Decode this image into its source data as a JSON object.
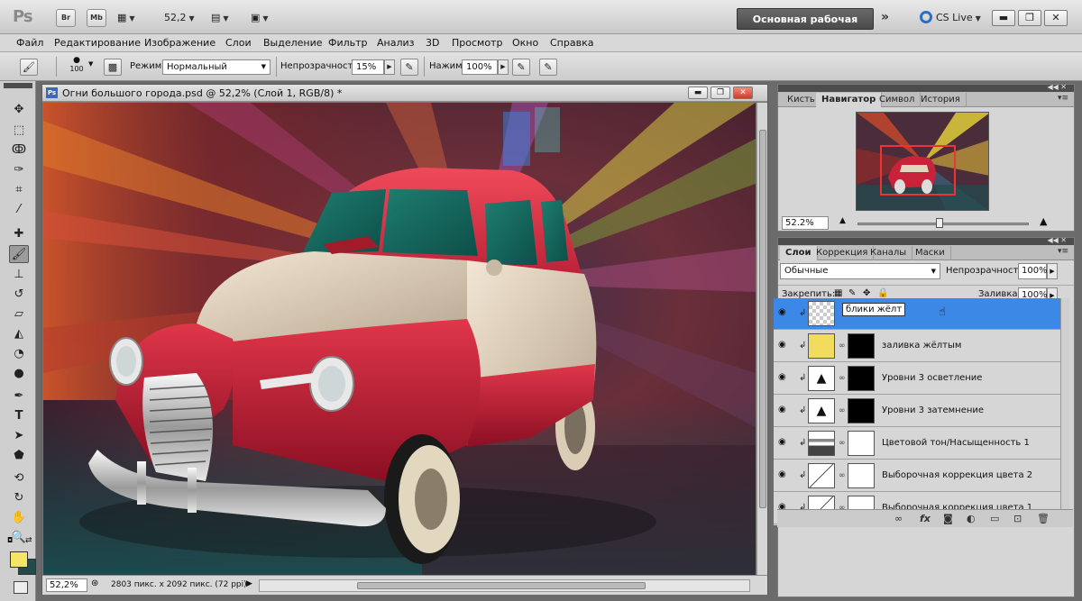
{
  "appbar": {
    "logo": "Ps",
    "br_label": "Br",
    "mb_label": "Mb",
    "zoom_value": "52,2",
    "workspace_label": "Основная рабочая среда",
    "more_label": "»",
    "cslive_label": "CS Live"
  },
  "menu": [
    "Файл",
    "Редактирование",
    "Изображение",
    "Слои",
    "Выделение",
    "Фильтр",
    "Анализ",
    "3D",
    "Просмотр",
    "Окно",
    "Справка"
  ],
  "options": {
    "brush_size": "100",
    "mode_label": "Режим:",
    "mode_value": "Нормальный",
    "opacity_label": "Непрозрачность:",
    "opacity_value": "15%",
    "flow_label": "Нажим:",
    "flow_value": "100%"
  },
  "document": {
    "title": "Огни большого города.psd @ 52,2% (Слой 1, RGB/8) *",
    "zoom": "52,2%",
    "info": "2803 пикс. x 2092 пикс. (72 ppi)"
  },
  "navigator_panel": {
    "tabs": [
      "Кисть",
      "Навигатор",
      "Символ",
      "История"
    ],
    "active_tab": 1,
    "zoom": "52.2%",
    "zoom_level": 0.48
  },
  "layers_panel": {
    "tabs": [
      "Слои",
      "Коррекция",
      "Каналы",
      "Маски"
    ],
    "active_tab": 0,
    "blend_mode": "Обычные",
    "opacity_label": "Непрозрачность:",
    "opacity_value": "100%",
    "lock_label": "Закрепить:",
    "fill_label": "Заливка:",
    "fill_value": "100%",
    "layers": [
      {
        "name": "блики жёлт",
        "editing": true,
        "selected": true,
        "thumb": "transparent"
      },
      {
        "name": "заливка жёлтым",
        "selected": false,
        "thumb": "yellow"
      },
      {
        "name": "Уровни 3 осветление",
        "selected": false,
        "thumb": "levels"
      },
      {
        "name": "Уровни 3 затемнение",
        "selected": false,
        "thumb": "levels"
      },
      {
        "name": "Цветовой тон/Насыщенность 1",
        "selected": false,
        "thumb": "hue"
      },
      {
        "name": "Выборочная коррекция цвета 2",
        "selected": false,
        "thumb": "selective"
      },
      {
        "name": "Выборочная коррекция цвета 1",
        "selected": false,
        "thumb": "selective"
      }
    ]
  },
  "colors": {
    "foreground": "#f4e468",
    "background": "#224b4d",
    "selection": "#3b88e6"
  }
}
